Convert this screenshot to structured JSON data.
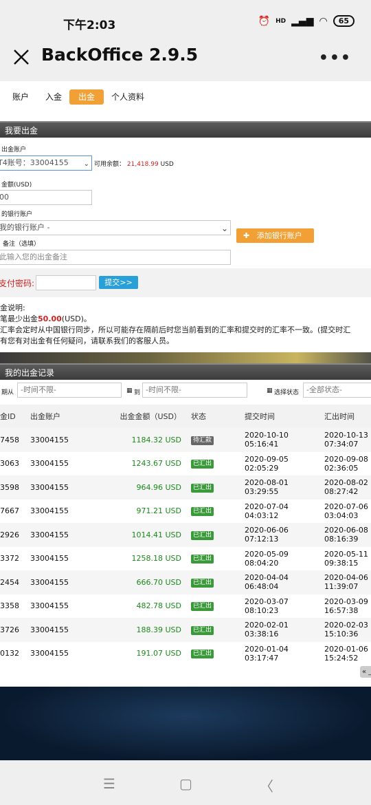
{
  "status": {
    "time": "下午2:03",
    "hd": "HD",
    "battery": "65"
  },
  "app": {
    "title": "BackOffice 2.9.5",
    "more": "•••"
  },
  "tabs": [
    "账户",
    "入金",
    "出金",
    "个人资料"
  ],
  "form": {
    "section_title": "我要出金",
    "account_label": "出金账户",
    "account_value": "T4账号：33004155",
    "available_label": "可用余额：",
    "available_value": "21,418.99",
    "available_unit": "USD",
    "amount_label": "金额(USD)",
    "amount_value": "00",
    "bank_label": "的银行账户",
    "bank_value": "我的银行账户 -",
    "add_bank": "添加银行账户",
    "note_label": "备注（选填）",
    "note_placeholder": "此输入您的出金备注",
    "pay_label": "支付密码:",
    "submit": "提交>>"
  },
  "notes": {
    "title": "金说明:",
    "line1_a": "笔最少出金",
    "line1_b": "50.00",
    "line1_c": "(USD)。",
    "line2": "汇率会定时从中国银行同步，所以可能存在隔前后时您当前看到的汇率和提交时的汇率不一致。(提交时汇",
    "line3": "有您有对出金有任何疑问，请联系我们的客服人员。"
  },
  "records": {
    "section_title": "我的出金记录",
    "date_from": "期从",
    "date_from_ph": "-时间不限-",
    "date_to": "到",
    "date_to_ph": "-时间不限-",
    "status_label": "选择状态",
    "status_value": "-全部状态-",
    "headers": [
      "金ID",
      "出金账户",
      "出金金额（USD）",
      "状态",
      "提交时间",
      "汇出时间"
    ],
    "rows": [
      [
        "7458",
        "33004155",
        "1184.32 USD",
        "待汇款",
        "2020-10-10",
        "05:16:41",
        "2020-10-13",
        "07:34:07"
      ],
      [
        "3063",
        "33004155",
        "1243.67 USD",
        "已汇出",
        "2020-09-05",
        "02:05:29",
        "2020-09-08",
        "02:36:05"
      ],
      [
        "3598",
        "33004155",
        "964.96 USD",
        "已汇出",
        "2020-08-01",
        "03:29:55",
        "2020-08-02",
        "08:27:42"
      ],
      [
        "7667",
        "33004155",
        "971.21 USD",
        "已汇出",
        "2020-07-04",
        "04:03:12",
        "2020-07-06",
        "03:04:03"
      ],
      [
        "2926",
        "33004155",
        "1014.41 USD",
        "已汇出",
        "2020-06-06",
        "07:12:13",
        "2020-06-08",
        "08:16:39"
      ],
      [
        "3372",
        "33004155",
        "1258.18 USD",
        "已汇出",
        "2020-05-09",
        "08:04:20",
        "2020-05-11",
        "09:38:15"
      ],
      [
        "2454",
        "33004155",
        "666.70 USD",
        "已汇出",
        "2020-04-04",
        "06:48:04",
        "2020-04-06",
        "11:39:07"
      ],
      [
        "3358",
        "33004155",
        "482.78 USD",
        "已汇出",
        "2020-03-07",
        "08:10:23",
        "2020-03-09",
        "16:57:38"
      ],
      [
        "3726",
        "33004155",
        "188.39 USD",
        "已汇出",
        "2020-02-01",
        "03:38:16",
        "2020-02-03",
        "15:10:36"
      ],
      [
        "0132",
        "33004155",
        "191.07 USD",
        "已汇出",
        "2020-01-04",
        "03:17:47",
        "2020-01-06",
        "15:24:52"
      ]
    ],
    "pager": "« _"
  },
  "colors": {
    "accent": "#f0a035",
    "submit": "#2aa0d8",
    "amount": "#1a8a1a",
    "red": "#cc2222"
  }
}
